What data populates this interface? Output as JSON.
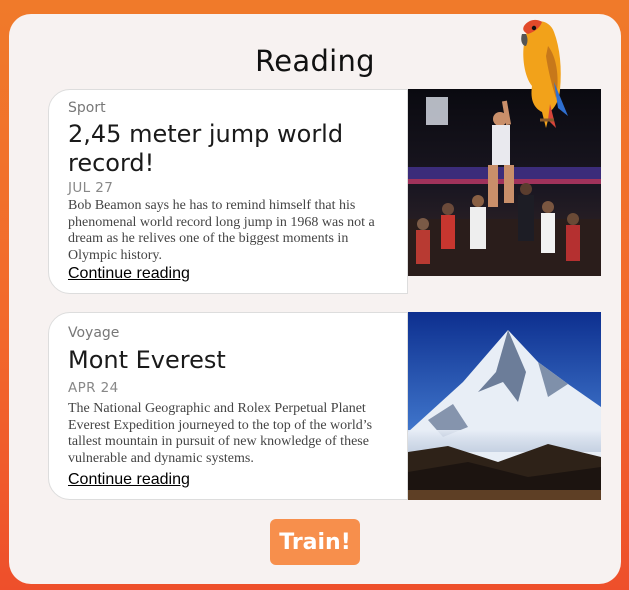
{
  "page": {
    "title": "Reading"
  },
  "articles": [
    {
      "category": "Sport",
      "headline": "2,45 meter jump world record!",
      "date": "JUL 27",
      "description": "Bob Beamon says he has to remind himself that his phenomenal world record long jump in 1968 was not a dream as he relives one of the biggest moments in Olympic history.",
      "link_label": "Continue reading",
      "image": "basketball-game-photo"
    },
    {
      "category": "Voyage",
      "headline": "Mont Everest",
      "date": "APR 24",
      "description": "The National Geographic and Rolex Perpetual Planet Everest Expedition journeyed to the top of the world’s tallest mountain in pursuit of new knowledge of these vulnerable and dynamic systems.",
      "link_label": "Continue reading",
      "image": "snowy-mountain-photo"
    }
  ],
  "actions": {
    "train_label": "Train!"
  },
  "mascot": "parrot-icon",
  "colors": {
    "accent": "#f78f4c",
    "background_top": "#f07a2a",
    "background_bottom": "#ee4f2b",
    "panel": "#f7f2f1"
  }
}
